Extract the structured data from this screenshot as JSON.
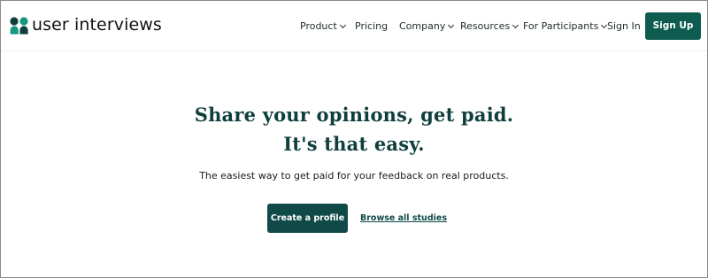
{
  "brand": {
    "name": "user interviews",
    "colors": {
      "primary": "#0e5c50",
      "dark_teal": "#0f3f3c",
      "logo_light": "#13977f"
    },
    "logo_icon": "user-interviews-logo-icon"
  },
  "nav": {
    "items": [
      {
        "label": "Product",
        "dropdown": true
      },
      {
        "label": "Pricing",
        "dropdown": false
      },
      {
        "label": "Company",
        "dropdown": true
      },
      {
        "label": "Resources",
        "dropdown": true
      },
      {
        "label": "For Participants",
        "dropdown": true
      }
    ],
    "sign_in": "Sign In",
    "sign_up": "Sign Up"
  },
  "hero": {
    "title_line1": "Share your opinions, get paid.",
    "title_line2": "It's that easy.",
    "subtitle": "The easiest way to get paid for your feedback on real products.",
    "primary_cta": "Create a profile",
    "secondary_cta": "Browse all studies"
  }
}
